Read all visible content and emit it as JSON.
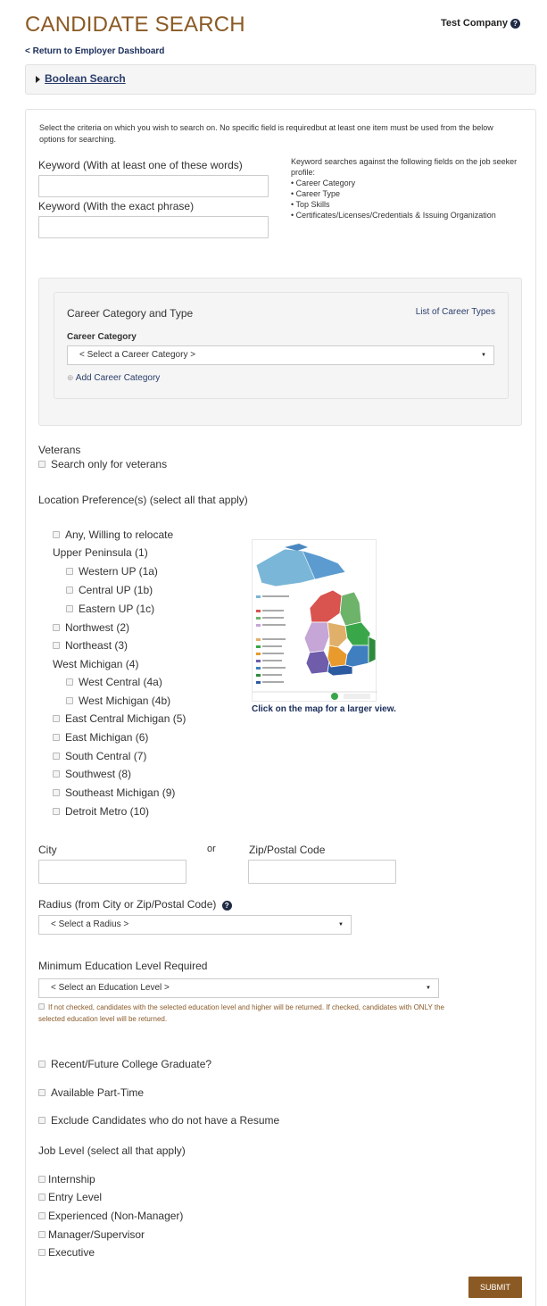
{
  "header": {
    "title": "CANDIDATE SEARCH",
    "company": "Test Company",
    "return_link": "< Return to Employer Dashboard",
    "boolean_search": "Boolean Search"
  },
  "instructions": "Select the criteria on which you wish to search on. No specific field is requiredbut at least one item must be used from the below options for searching.",
  "keyword": {
    "any_label": "Keyword (With at least one of these words)",
    "any_value": "",
    "exact_label": "Keyword (With the exact phrase)",
    "exact_value": "",
    "help_intro": "Keyword searches against the following fields on the job seeker profile:",
    "help_fields": [
      "• Career Category",
      "• Career Type",
      "• Top Skills",
      "• Certificates/Licenses/Credentials & Issuing Organization"
    ]
  },
  "career": {
    "heading": "Career Category and Type",
    "list_link": "List of Career Types",
    "category_label": "Career Category",
    "category_selected": "< Select a Career Category >",
    "add_link": "Add Career Category"
  },
  "veterans": {
    "heading": "Veterans",
    "option": "Search only for veterans"
  },
  "location": {
    "heading": "Location Preference(s) (select all that apply)",
    "items": {
      "any": "Any, Willing to relocate",
      "upper": "Upper Peninsula (1)",
      "western_up": "Western UP (1a)",
      "central_up": "Central UP (1b)",
      "eastern_up": "Eastern UP (1c)",
      "northwest": "Northwest (2)",
      "northeast": "Northeast (3)",
      "west_michigan": "West Michigan (4)",
      "west_central": "West Central (4a)",
      "west_michigan_b": "West Michigan (4b)",
      "east_central": "East Central Michigan (5)",
      "east_michigan": "East Michigan (6)",
      "south_central": "South Central (7)",
      "southwest": "Southwest (8)",
      "southeast": "Southeast Michigan (9)",
      "detroit": "Detroit Metro (10)"
    },
    "map_caption": "Click on the map for a larger view."
  },
  "city": {
    "label": "City",
    "or": "or",
    "zip_label": "Zip/Postal Code",
    "city_value": "",
    "zip_value": ""
  },
  "radius": {
    "label": "Radius (from City or Zip/Postal Code)",
    "selected": "< Select a Radius >"
  },
  "education": {
    "label": "Minimum Education Level Required",
    "selected": "< Select an Education Level >",
    "note": "If not checked, candidates with the selected education level and higher will be returned. If checked, candidates with ONLY the selected education level will be returned."
  },
  "options": {
    "graduate": "Recent/Future College Graduate?",
    "part_time": "Available Part-Time",
    "exclude_no_resume": "Exclude Candidates who do not have a Resume"
  },
  "job_level": {
    "heading": "Job Level (select all that apply)",
    "items": [
      "Internship",
      "Entry Level",
      "Experienced (Non-Manager)",
      "Manager/Supervisor",
      "Executive"
    ]
  },
  "submit_label": "SUBMIT",
  "colors": {
    "brand": "#8b5a24",
    "link": "#2a3d6b"
  }
}
